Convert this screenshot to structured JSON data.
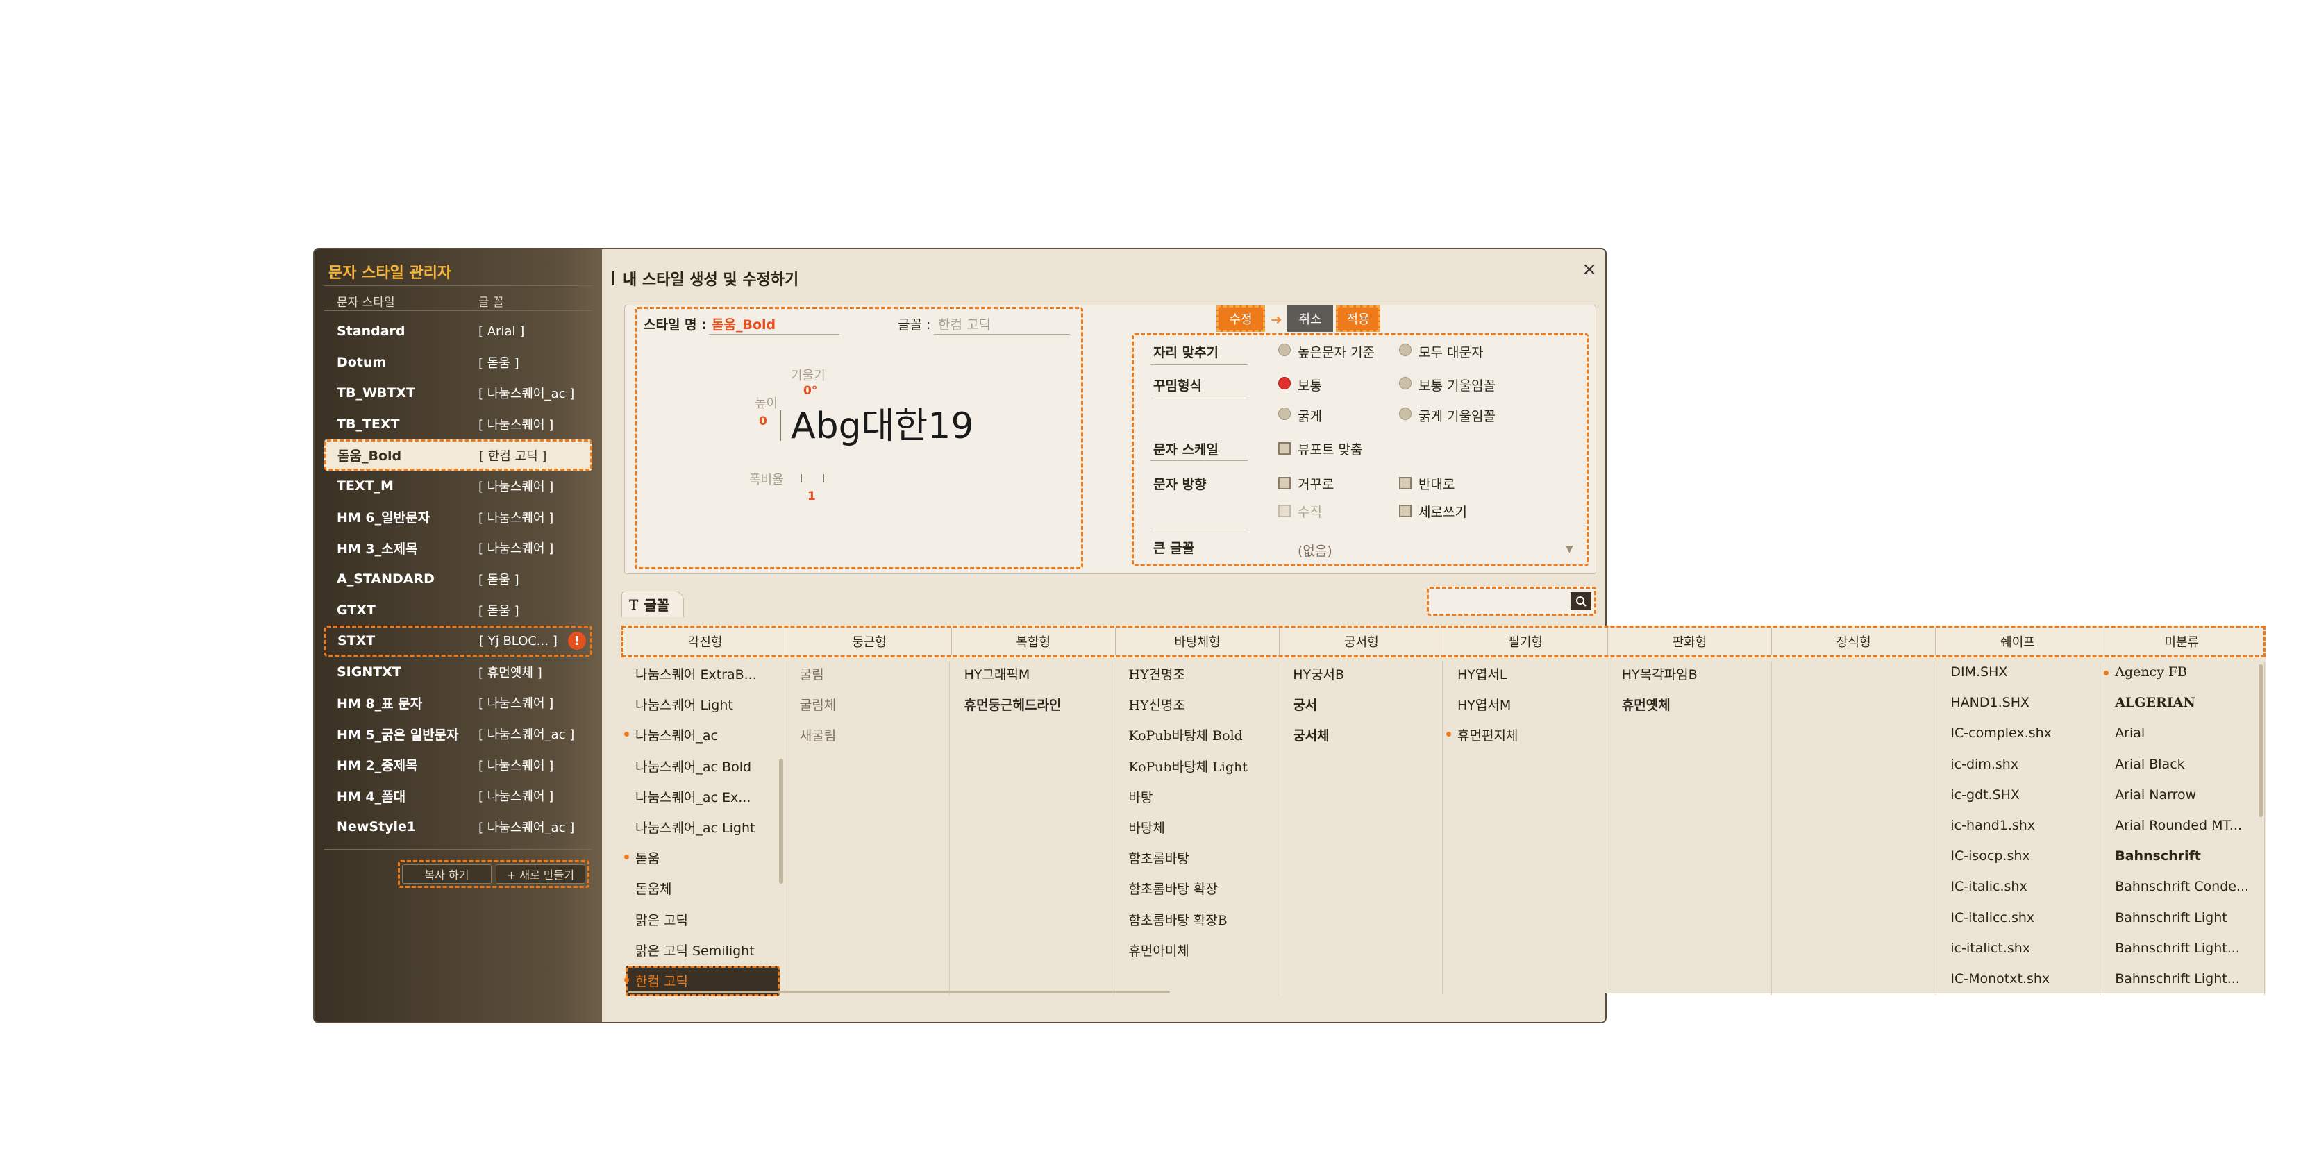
{
  "sidebar": {
    "title": "문자 스타일 관리자",
    "col_style": "문자 스타일",
    "col_font": "글 꼴",
    "styles": [
      {
        "name": "Standard",
        "font": "[ Arial ]"
      },
      {
        "name": "Dotum",
        "font": "[ 돋움 ]"
      },
      {
        "name": "TB_WBTXT",
        "font": "[ 나눔스퀘어_ac ]"
      },
      {
        "name": "TB_TEXT",
        "font": "[ 나눔스퀘어 ]"
      },
      {
        "name": "돋움_Bold",
        "font": "[ 한컴 고딕 ]"
      },
      {
        "name": "TEXT_M",
        "font": "[ 나눔스퀘어 ]"
      },
      {
        "name": "HM 6_일반문자",
        "font": "[ 나눔스퀘어 ]"
      },
      {
        "name": "HM 3_소제목",
        "font": "[ 나눔스퀘어 ]"
      },
      {
        "name": "A_STANDARD",
        "font": "[ 돋움 ]"
      },
      {
        "name": "GTXT",
        "font": "[ 돋움 ]"
      },
      {
        "name": "STXT",
        "font": "[ Yj BLOC... ]"
      },
      {
        "name": "SIGNTXT",
        "font": "[ 휴먼옛체 ]"
      },
      {
        "name": "HM 8_표 문자",
        "font": "[ 나눔스퀘어 ]"
      },
      {
        "name": "HM 5_굵은 일반문자",
        "font": "[ 나눔스퀘어_ac ]"
      },
      {
        "name": "HM 2_중제목",
        "font": "[ 나눔스퀘어 ]"
      },
      {
        "name": "HM 4_폴대",
        "font": "[ 나눔스퀘어 ]"
      },
      {
        "name": "NewStyle1",
        "font": "[ 나눔스퀘어_ac ]"
      }
    ],
    "selected_index": 4,
    "error_index": 10,
    "warn_icon": "!",
    "copy_button": "복사 하기",
    "new_button": "+ 새로 만들기"
  },
  "main": {
    "title": "내 스타일 생성 및 수정하기",
    "close": "×",
    "style_name_label": "스타일 명 :",
    "style_name_value": "돋움_Bold",
    "font_label": "글꼴 :",
    "font_value": "한컴 고딕",
    "slant_label": "기울기",
    "slant_value": "0°",
    "height_label": "높이",
    "height_value": "0",
    "preview_text": "Abg대한19",
    "width_ratio_label": "폭비율",
    "width_ratio_value": "1",
    "align_label": "자리 맞추기",
    "align_opt1": "높은문자 기준",
    "align_opt2": "모두 대문자",
    "decor_label": "꾸밈형식",
    "decor_opt1": "보통",
    "decor_opt2": "보통 기울임꼴",
    "decor_opt3": "굵게",
    "decor_opt4": "굵게 기울임꼴",
    "scale_label": "문자 스케일",
    "scale_opt": "뷰포트 맞춤",
    "dir_label": "문자 방향",
    "dir_opt1": "거꾸로",
    "dir_opt2": "반대로",
    "dir_opt3": "수직",
    "dir_opt4": "세로쓰기",
    "big_font_label": "큰 글꼴",
    "big_font_value": "(없음)",
    "edit_button": "수정",
    "cancel_button": "취소",
    "apply_button": "적용",
    "font_tab_icon": "T",
    "font_tab": "글꼴"
  },
  "font_categories": [
    "각진형",
    "둥근형",
    "복합형",
    "바탕체형",
    "궁서형",
    "필기형",
    "판화형",
    "장식형",
    "쉐이프",
    "미분류"
  ],
  "font_columns": [
    [
      "나눔스퀘어 ExtraB...",
      "나눔스퀘어 Light",
      "나눔스퀘어_ac",
      "나눔스퀘어_ac Bold",
      "나눔스퀘어_ac Ex...",
      "나눔스퀘어_ac Light",
      "돋움",
      "돋움체",
      "맑은 고딕",
      "맑은 고딕 Semilight",
      "한컴 고딕"
    ],
    [
      "굴림",
      "굴림체",
      "새굴림"
    ],
    [
      "HY그래픽M",
      "휴먼둥근헤드라인"
    ],
    [
      "HY견명조",
      "HY신명조",
      "KoPub바탕체 Bold",
      "KoPub바탕체 Light",
      "바탕",
      "바탕체",
      "함초롬바탕",
      "함초롬바탕 확장",
      "함초롬바탕 확장B",
      "휴먼아미체"
    ],
    [
      "HY궁서B",
      "궁서",
      "궁서체"
    ],
    [
      "HY엽서L",
      "HY엽서M",
      "휴먼편지체"
    ],
    [
      "HY목각파임B",
      "휴먼옛체"
    ],
    [],
    [
      "DIM.SHX",
      "HAND1.SHX",
      "IC-complex.shx",
      "ic-dim.shx",
      "ic-gdt.SHX",
      "ic-hand1.shx",
      "IC-isocp.shx",
      "IC-italic.shx",
      "IC-italicc.shx",
      "ic-italict.shx",
      "IC-Monotxt.shx"
    ],
    [
      "Agency FB",
      "ALGERIAN",
      "Arial",
      "Arial Black",
      "Arial Narrow",
      "Arial Rounded MT...",
      "Bahnschrift",
      "Bahnschrift Conde...",
      "Bahnschrift Light",
      "Bahnschrift Light...",
      "Bahnschrift Light..."
    ]
  ],
  "colors": {
    "accent": "#ef7a1a",
    "sidebar_bg": "#3a3124",
    "title": "#f5b43a",
    "danger": "#e5511f"
  }
}
